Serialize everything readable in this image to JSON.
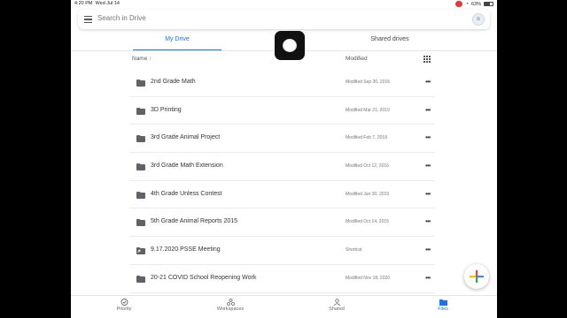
{
  "status": {
    "time": "4:20 PM",
    "date": "Wed Jul 14",
    "recording": "",
    "battery": "63%"
  },
  "search": {
    "placeholder": "Search in Drive"
  },
  "tabs": [
    {
      "label": "My Drive"
    },
    {
      "label": "Shared drives"
    }
  ],
  "columns": {
    "name": "Name",
    "sort_indicator": "↑",
    "modified": "Modified"
  },
  "files": [
    {
      "name": "2nd Grade Math",
      "modified": "Modified Sep 30, 2016",
      "icon": "folder-icon"
    },
    {
      "name": "3D Printing",
      "modified": "Modified Mar 21, 2019",
      "icon": "folder-icon"
    },
    {
      "name": "3rd Grade Animal Project",
      "modified": "Modified Feb 7, 2018",
      "icon": "folder-icon"
    },
    {
      "name": "3rd Grade Math Extension",
      "modified": "Modified Oct 12, 2016",
      "icon": "folder-icon"
    },
    {
      "name": "4th Grade Unless Contest",
      "modified": "Modified Jan 30, 2019",
      "icon": "folder-icon"
    },
    {
      "name": "5th Grade Animal Reports 2015",
      "modified": "Modified Oct 14, 2015",
      "icon": "folder-icon"
    },
    {
      "name": "9.17.2020 PSSE Meeting",
      "modified": "Shortcut",
      "icon": "folder-shortcut-icon"
    },
    {
      "name": "20-21 COVID School Reopening Work",
      "modified": "Modified Nov 18, 2020",
      "icon": "folder-icon"
    }
  ],
  "bottom_nav": [
    {
      "label": "Priority",
      "icon": "priority-icon"
    },
    {
      "label": "Workspaces",
      "icon": "workspaces-icon"
    },
    {
      "label": "Shared",
      "icon": "shared-icon"
    },
    {
      "label": "Files",
      "icon": "files-icon",
      "active": true
    }
  ],
  "colors": {
    "accent": "#1a73e8",
    "fab_red": "#ea4335",
    "fab_yellow": "#fbbc04",
    "fab_green": "#34a853",
    "fab_blue": "#4285f4"
  }
}
